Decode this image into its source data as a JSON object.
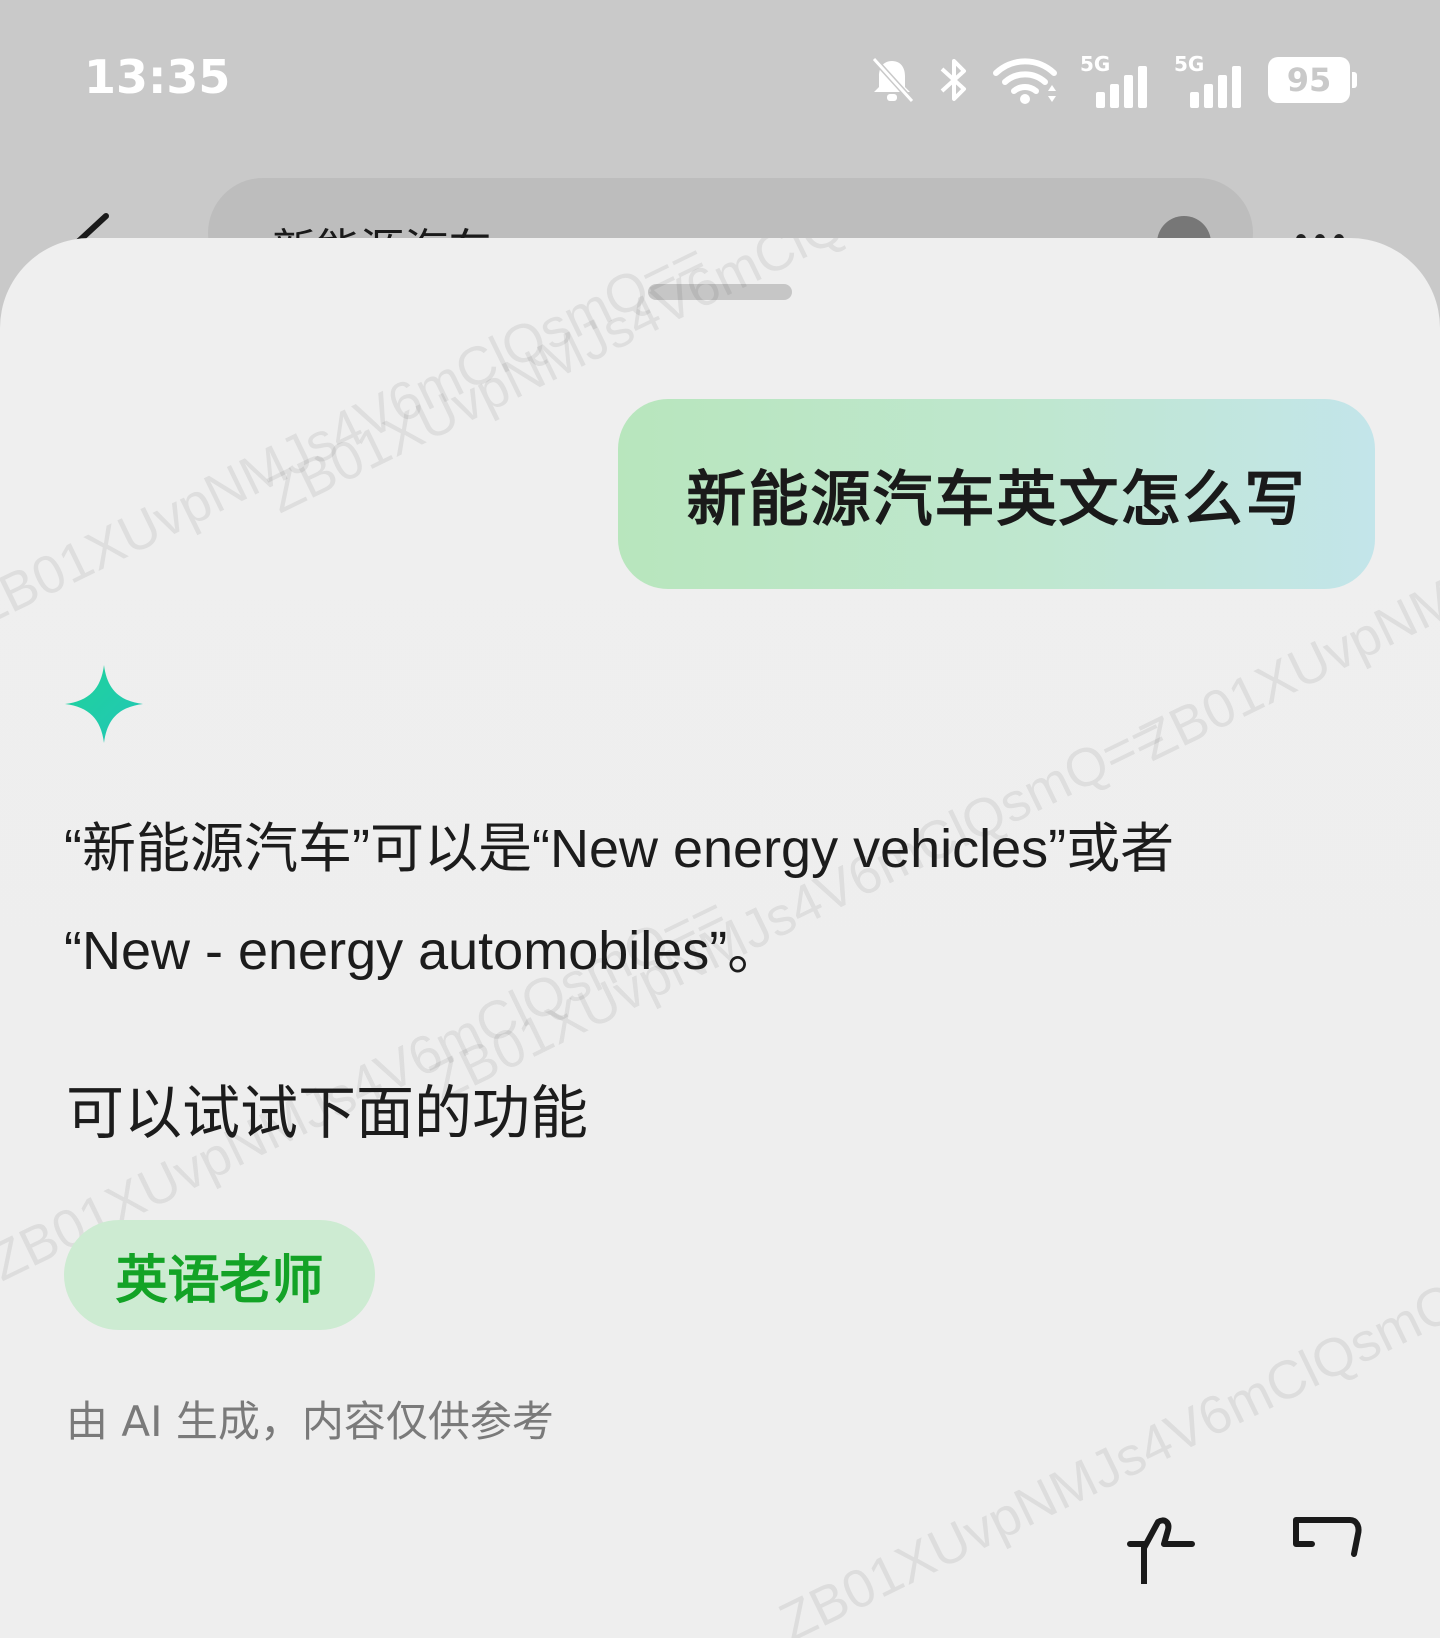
{
  "status_bar": {
    "time": "13:35",
    "icons": [
      "mute-bell-icon",
      "bluetooth-icon",
      "wifi-icon"
    ],
    "network": [
      "5G",
      "5G"
    ],
    "battery": "95"
  },
  "search": {
    "query": "新能源汽车"
  },
  "watermark": {
    "text": "ZB01XUvpNMJs4V6mClQsmQ=="
  },
  "chat": {
    "user_message": "新能源汽车英文怎么写",
    "answer_line1": "“新能源汽车”可以是“New energy vehicles”或者",
    "answer_line2": "“New - energy automobiles”。",
    "try_label": "可以试试下面的功能",
    "suggestion_chip": "英语老师",
    "disclaimer": "由 AI 生成，内容仅供参考"
  },
  "colors": {
    "accent_green": "#13a326",
    "chip_bg": "#cdebd2",
    "star_gradient": [
      "#1fd39a",
      "#22c6b7"
    ]
  }
}
